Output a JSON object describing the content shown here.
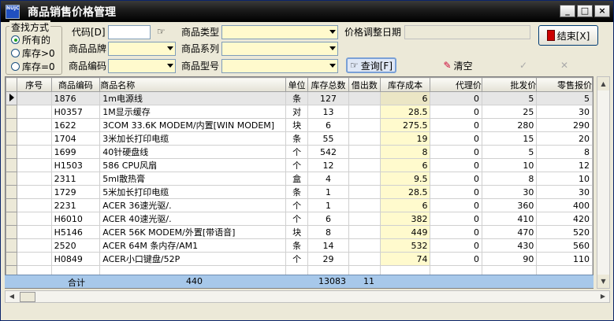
{
  "window": {
    "title": "商品销售价格管理",
    "icon_text": "NUJC",
    "min_label": "_",
    "max_label": "□",
    "close_label": "×"
  },
  "search_mode": {
    "legend": "查找方式",
    "options": [
      {
        "label": "所有的",
        "checked": true
      },
      {
        "label": "库存>0",
        "checked": false
      },
      {
        "label": "库存=0",
        "checked": false
      }
    ]
  },
  "filters": {
    "code_label": "代码[D]",
    "code_value": "",
    "brand_label": "商品品牌",
    "brand_value": "",
    "sku_label": "商品编码",
    "sku_value": "",
    "type_label": "商品类型",
    "type_value": "",
    "series_label": "商品系列",
    "series_value": "",
    "model_label": "商品型号",
    "model_value": "",
    "date_label": "价格调整日期",
    "date_value": ""
  },
  "buttons": {
    "close": "结束[X]",
    "query": "查询[F]",
    "clear": "清空",
    "check": "✓",
    "cancel": "✕"
  },
  "table": {
    "columns": [
      "序号",
      "商品编码",
      "商品名称",
      "单位",
      "库存总数",
      "借出数",
      "库存成本",
      "代理价",
      "批发价",
      "零售报价"
    ],
    "rows": [
      [
        "",
        "1876",
        "1m电源线",
        "条",
        "127",
        "",
        "6",
        "0",
        "5",
        "5"
      ],
      [
        "",
        "H0357",
        "1M显示缓存",
        "对",
        "13",
        "",
        "28.5",
        "0",
        "25",
        "30"
      ],
      [
        "",
        "1622",
        "3COM 33.6K MODEM/内置[WIN MODEM]",
        "块",
        "6",
        "",
        "275.5",
        "0",
        "280",
        "290"
      ],
      [
        "",
        "1704",
        "3米加长打印电缆",
        "条",
        "55",
        "",
        "19",
        "0",
        "15",
        "20"
      ],
      [
        "",
        "1699",
        "40针硬盘线",
        "个",
        "542",
        "",
        "8",
        "0",
        "5",
        "8"
      ],
      [
        "",
        "H1503",
        "586 CPU风扇",
        "个",
        "12",
        "",
        "6",
        "0",
        "10",
        "12"
      ],
      [
        "",
        "2311",
        "5ml散热膏",
        "盒",
        "4",
        "",
        "9.5",
        "0",
        "8",
        "10"
      ],
      [
        "",
        "1729",
        "5米加长打印电缆",
        "条",
        "1",
        "",
        "28.5",
        "0",
        "30",
        "30"
      ],
      [
        "",
        "2231",
        "ACER 36速光驱/.",
        "个",
        "1",
        "",
        "6",
        "0",
        "360",
        "400"
      ],
      [
        "",
        "H6010",
        "ACER 40速光驱/.",
        "个",
        "6",
        "",
        "382",
        "0",
        "410",
        "420"
      ],
      [
        "",
        "H5146",
        "ACER 56K MODEM/外置[带语音]",
        "块",
        "8",
        "",
        "449",
        "0",
        "470",
        "520"
      ],
      [
        "",
        "2520",
        "ACER 64M 条内存/AM1",
        "条",
        "14",
        "",
        "532",
        "0",
        "430",
        "560"
      ],
      [
        "",
        "H0849",
        "ACER小口键盘/52P",
        "个",
        "29",
        "",
        "74",
        "0",
        "90",
        "110"
      ]
    ],
    "selected_row": 0
  },
  "totals": {
    "label": "合计",
    "count": "440",
    "stock_total": "13083",
    "lent_total": "11"
  }
}
